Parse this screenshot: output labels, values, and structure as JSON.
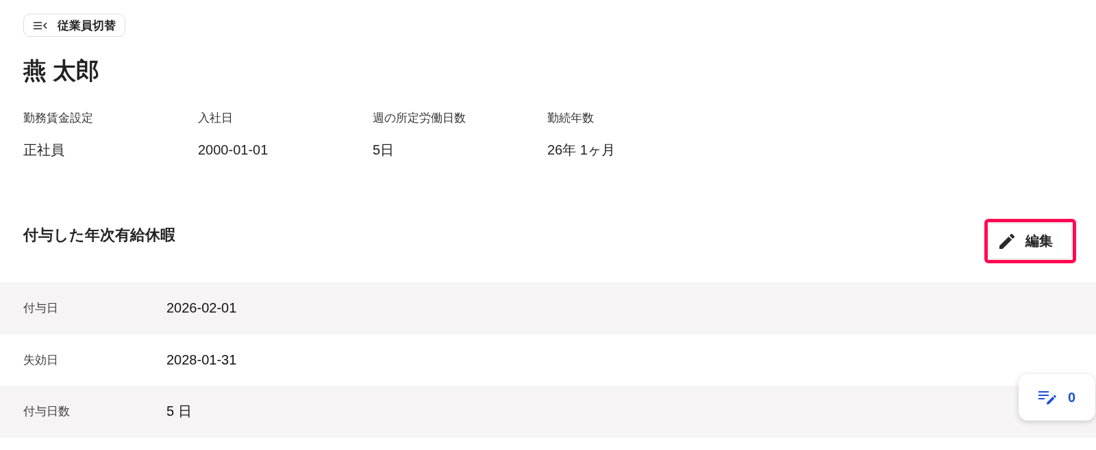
{
  "switch_button": {
    "label": "従業員切替"
  },
  "employee_name": "燕 太郎",
  "summary": [
    {
      "label": "勤務賃金設定",
      "value": "正社員"
    },
    {
      "label": "入社日",
      "value": "2000-01-01"
    },
    {
      "label": "週の所定労働日数",
      "value": "5日"
    },
    {
      "label": "勤続年数",
      "value": "26年 1ヶ月"
    }
  ],
  "section": {
    "title": "付与した年次有給休暇",
    "edit_button": {
      "label": "編集",
      "highlighted": true
    }
  },
  "grant_details": [
    {
      "label": "付与日",
      "value": "2026-02-01"
    },
    {
      "label": "失効日",
      "value": "2028-01-31"
    },
    {
      "label": "付与日数",
      "value": "5 日"
    }
  ],
  "floating_button": {
    "count": "0"
  }
}
